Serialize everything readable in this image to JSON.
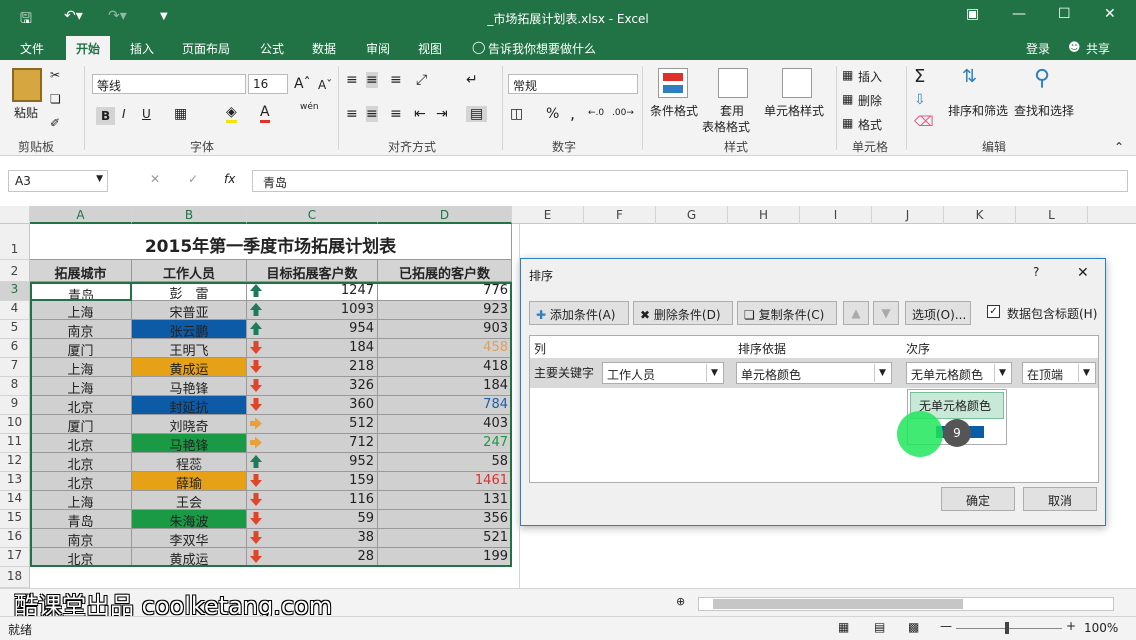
{
  "window": {
    "title": "_市场拓展计划表.xlsx - Excel"
  },
  "tabs": [
    "文件",
    "开始",
    "插入",
    "页面布局",
    "公式",
    "数据",
    "审阅",
    "视图"
  ],
  "tell_me": "告诉我你想要做什么",
  "login": "登录",
  "share": "共享",
  "ribbon": {
    "paste": "粘贴",
    "clipboard": "剪贴板",
    "font_name": "等线",
    "font_size": "16",
    "font_group": "字体",
    "align_group": "对齐方式",
    "number_format": "常规",
    "number_group": "数字",
    "cond_format": "条件格式",
    "table_format_1": "套用",
    "table_format_2": "表格格式",
    "cell_style": "单元格样式",
    "style_group": "样式",
    "insert": "插入",
    "delete": "删除",
    "format": "格式",
    "cells_group": "单元格",
    "sort_filter": "排序和筛选",
    "find_select": "查找和选择",
    "edit_group": "编辑",
    "bold": "B",
    "italic": "I",
    "underline": "U",
    "percent": "%",
    "comma": ",",
    "wen": "wén"
  },
  "formula": {
    "name_box": "A3",
    "fx": "fx",
    "value": "青岛"
  },
  "columns": [
    "A",
    "B",
    "C",
    "D",
    "E",
    "F",
    "G",
    "H",
    "I",
    "J",
    "K",
    "L"
  ],
  "sheet": {
    "title": "2015年第一季度市场拓展计划表",
    "headers": [
      "拓展城市",
      "工作人员",
      "目标拓展客户数",
      "已拓展的客户数"
    ],
    "rows": [
      {
        "n": "3",
        "city": "青岛",
        "person": "彭　雷",
        "target": "1247",
        "done": "776",
        "arrow": "up",
        "pfill": "",
        "dcolor": ""
      },
      {
        "n": "4",
        "city": "上海",
        "person": "宋普亚",
        "target": "1093",
        "done": "923",
        "arrow": "up",
        "pfill": "",
        "dcolor": ""
      },
      {
        "n": "5",
        "city": "南京",
        "person": "张云鹏",
        "target": "954",
        "done": "903",
        "arrow": "up",
        "pfill": "#0d5aa7",
        "dcolor": ""
      },
      {
        "n": "6",
        "city": "厦门",
        "person": "王明飞",
        "target": "184",
        "done": "458",
        "arrow": "down",
        "pfill": "",
        "dcolor": "#e2a05a"
      },
      {
        "n": "7",
        "city": "上海",
        "person": "黄成运",
        "target": "218",
        "done": "418",
        "arrow": "down",
        "pfill": "#e6a117",
        "dcolor": ""
      },
      {
        "n": "8",
        "city": "上海",
        "person": "马艳锋",
        "target": "326",
        "done": "184",
        "arrow": "down",
        "pfill": "",
        "dcolor": ""
      },
      {
        "n": "9",
        "city": "北京",
        "person": "封延抗",
        "target": "360",
        "done": "784",
        "arrow": "down",
        "pfill": "#0d5aa7",
        "dcolor": "#1f5fa8"
      },
      {
        "n": "10",
        "city": "厦门",
        "person": "刘晓奇",
        "target": "512",
        "done": "403",
        "arrow": "right",
        "pfill": "",
        "dcolor": ""
      },
      {
        "n": "11",
        "city": "北京",
        "person": "马艳锋",
        "target": "712",
        "done": "247",
        "arrow": "right",
        "pfill": "#1a9a45",
        "dcolor": "#1a9a45"
      },
      {
        "n": "12",
        "city": "北京",
        "person": "程蕊",
        "target": "952",
        "done": "58",
        "arrow": "up",
        "pfill": "",
        "dcolor": ""
      },
      {
        "n": "13",
        "city": "北京",
        "person": "薛瑜",
        "target": "159",
        "done": "1461",
        "arrow": "down",
        "pfill": "#e6a117",
        "dcolor": "#e0302a"
      },
      {
        "n": "14",
        "city": "上海",
        "person": "王会",
        "target": "116",
        "done": "131",
        "arrow": "down",
        "pfill": "",
        "dcolor": ""
      },
      {
        "n": "15",
        "city": "青岛",
        "person": "朱海波",
        "target": "59",
        "done": "356",
        "arrow": "down",
        "pfill": "#1a9a45",
        "dcolor": ""
      },
      {
        "n": "16",
        "city": "南京",
        "person": "李双华",
        "target": "38",
        "done": "521",
        "arrow": "down",
        "pfill": "",
        "dcolor": ""
      },
      {
        "n": "17",
        "city": "北京",
        "person": "黄成运",
        "target": "28",
        "done": "199",
        "arrow": "down",
        "pfill": "",
        "dcolor": ""
      }
    ]
  },
  "dialog": {
    "title": "排序",
    "help": "?",
    "add": "添加条件(A)",
    "delete": "删除条件(D)",
    "copy": "复制条件(C)",
    "options": "选项(O)...",
    "has_header": "数据包含标题(H)",
    "col_header": "列",
    "sort_on_header": "排序依据",
    "order_header": "次序",
    "primary_key": "主要关键字",
    "column_value": "工作人员",
    "sort_on_value": "单元格颜色",
    "order_value": "无单元格颜色",
    "position_value": "在顶端",
    "dropdown_option": "无单元格颜色",
    "badge": "9",
    "ok": "确定",
    "cancel": "取消"
  },
  "status": {
    "ready": "就绪",
    "zoom": "100%"
  },
  "watermark": "酷课堂出品 coolketang.com",
  "colors": {
    "excel_green": "#217346",
    "blue_fill": "#0d5aa7",
    "orange_fill": "#e6a117",
    "green_fill": "#1a9a45",
    "arrow_up": "#1e7a5a",
    "arrow_down": "#e0452a",
    "arrow_right": "#e8a03a"
  }
}
